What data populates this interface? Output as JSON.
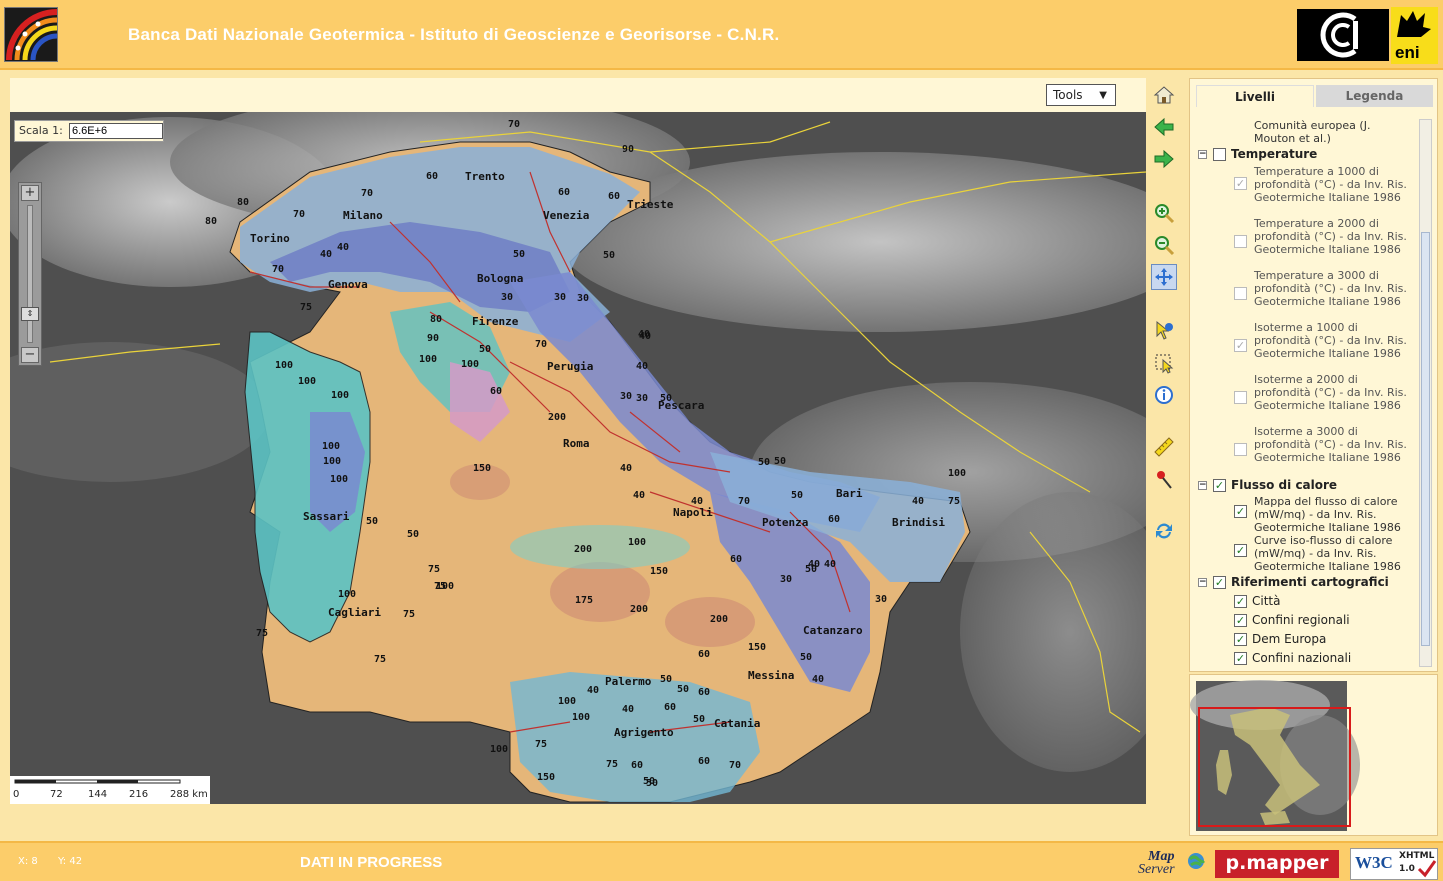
{
  "header": {
    "title": "Banca Dati Nazionale Geotermica -  Istituto di Geoscienze e Georisorse - C.N.R.",
    "eni_text": "eni"
  },
  "map": {
    "tools_label": "Tools",
    "scale_label": "Scala 1:",
    "scale_value": "6.6E+6",
    "scalebar_labels": [
      "0",
      "72",
      "144",
      "216",
      "288 km"
    ],
    "cities": [
      "Trento",
      "Milano",
      "Venezia",
      "Trieste",
      "Torino",
      "Bologna",
      "Genova",
      "Firenze",
      "Perugia",
      "Pescara",
      "Roma",
      "Napoli",
      "Bari",
      "Potenza",
      "Brindisi",
      "Sassari",
      "Cagliari",
      "Catanzaro",
      "Messina",
      "Palermo",
      "Agrigento",
      "Catania"
    ],
    "contour_labels": {
      "north": [
        "70",
        "90",
        "60",
        "70",
        "80",
        "70",
        "60",
        "80",
        "70",
        "60",
        "40",
        "50",
        "40",
        "30",
        "30",
        "30",
        "50",
        "40"
      ],
      "center": [
        "100",
        "100",
        "90",
        "80",
        "50",
        "70",
        "60",
        "200",
        "150",
        "30",
        "40",
        "30",
        "50",
        "40",
        "40"
      ],
      "south": [
        "200",
        "175",
        "200",
        "150",
        "200",
        "150",
        "100",
        "75",
        "100",
        "50",
        "40",
        "30",
        "50",
        "40",
        "40",
        "30",
        "60",
        "50",
        "60"
      ],
      "sardinia": [
        "75",
        "100",
        "100",
        "100",
        "100",
        "100",
        "100",
        "50",
        "50",
        "75",
        "100",
        "75",
        "75",
        "75"
      ],
      "sicily": [
        "100",
        "40",
        "60",
        "50",
        "60",
        "100",
        "40",
        "50",
        "100",
        "75",
        "75",
        "60",
        "60",
        "50",
        "70",
        "150",
        "50"
      ],
      "puglia": [
        "100",
        "50",
        "40",
        "50",
        "40",
        "75",
        "60",
        "40",
        "50",
        "70"
      ]
    }
  },
  "toolbar": {
    "tools": [
      "home-icon",
      "back-icon",
      "forward-icon",
      "zoom-in-icon",
      "zoom-out-icon",
      "pan-icon",
      "identify-icon",
      "select-icon",
      "info-icon",
      "measure-icon",
      "pin-icon",
      "refresh-icon"
    ]
  },
  "panel": {
    "tab_livelli": "Livelli",
    "tab_legenda": "Legenda",
    "first_item": "Comunità europea (J. Mouton et al.)",
    "temperature": {
      "label": "Temperature",
      "items": [
        "Temperature a 1000 di profondità (°C) - da Inv. Ris. Geotermiche Italiane 1986",
        "Temperature a 2000 di profondità (°C) - da Inv. Ris. Geotermiche Italiane 1986",
        "Temperature a 3000 di profondità (°C) - da Inv. Ris. Geotermiche Italiane 1986",
        "Isoterme a 1000 di profondità (°C) - da Inv. Ris. Geotermiche Italiane 1986",
        "Isoterme a 2000 di profondità (°C) - da Inv. Ris. Geotermiche Italiane 1986",
        "Isoterme a 3000 di profondità (°C) - da Inv. Ris. Geotermiche Italiane 1986"
      ]
    },
    "flusso": {
      "label": "Flusso di calore",
      "items": [
        "Mappa del flusso di calore (mW/mq) - da Inv. Ris. Geotermiche Italiane 1986",
        "Curve iso-flusso di calore (mW/mq) - da Inv. Ris. Geotermiche Italiane 1986"
      ]
    },
    "riferimenti": {
      "label": "Riferimenti cartografici",
      "items": [
        "Città",
        "Confini regionali",
        "Dem Europa",
        "Confini nazionali"
      ]
    }
  },
  "footer": {
    "x_label": "X: 8",
    "y_label": "Y: 42",
    "progress_text": "DATI IN PROGRESS",
    "mapserver_top": "Map",
    "mapserver_bottom": "Server",
    "pmapper": "p.mapper",
    "w3c": "W3C",
    "xhtml": "XHTML",
    "xhtml_version": "1.0"
  }
}
